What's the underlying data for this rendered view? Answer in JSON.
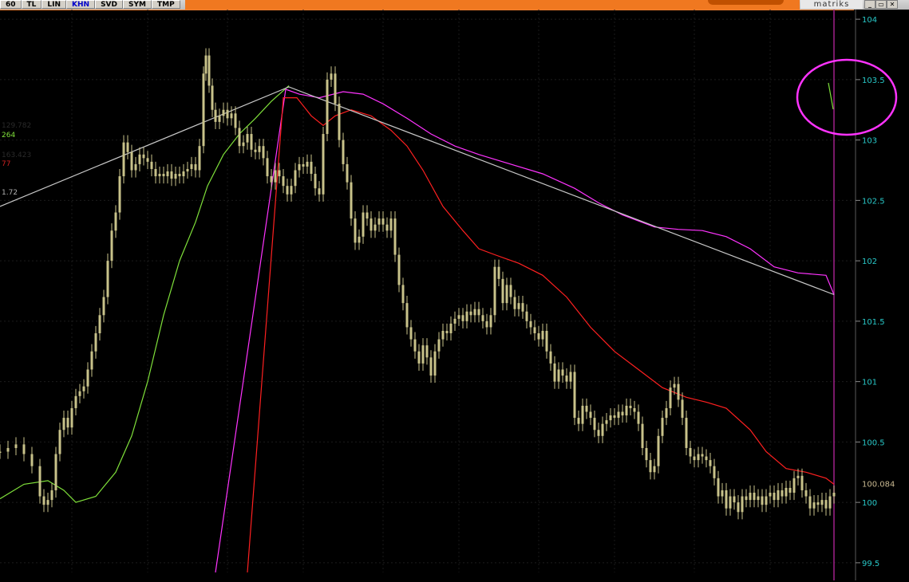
{
  "toolbar": {
    "buttons": [
      "60",
      "TL",
      "LIN",
      "KHN",
      "SVD",
      "SYM",
      "TMP"
    ],
    "active": "KHN",
    "brand": "matriks",
    "window_controls": [
      "_",
      "▭",
      "✕"
    ]
  },
  "colors": {
    "background": "#000000",
    "candle": "#c8c28a",
    "ma_magenta": "#ff33ff",
    "ma_red": "#ff2020",
    "ma_green": "#7fe03a",
    "trendline": "#c8c8c8",
    "axis_labels": "#28c8c8",
    "highlight_circle": "#ff33ff"
  },
  "legend": [
    {
      "text": "129.782",
      "color": "#2a2a2a"
    },
    {
      "text": "264",
      "color": "#7fe03a"
    },
    {
      "text": "163.423",
      "color": "#2a2a2a"
    },
    {
      "text": "77",
      "color": "#d02020"
    },
    {
      "text": "1.72",
      "color": "#b0b0b0"
    }
  ],
  "chart_data": {
    "type": "line",
    "subtype": "candlestick",
    "ylim": [
      99.42,
      104.08
    ],
    "yticks": [
      99.5,
      100,
      100.5,
      101,
      101.5,
      102,
      102.5,
      103,
      103.5,
      104
    ],
    "ytick_labels": [
      "99.5",
      "100",
      "100.5",
      "101",
      "101.5",
      "102",
      "102.5",
      "103",
      "103.5",
      "104"
    ],
    "last_price": "100.084",
    "x_index_range": [
      0,
      1045
    ],
    "candles_close": [
      [
        0,
        100.42
      ],
      [
        10,
        100.45
      ],
      [
        20,
        100.48
      ],
      [
        30,
        100.4
      ],
      [
        40,
        100.3
      ],
      [
        50,
        100.05
      ],
      [
        55,
        99.98
      ],
      [
        60,
        100.02
      ],
      [
        65,
        100.1
      ],
      [
        70,
        100.4
      ],
      [
        75,
        100.6
      ],
      [
        80,
        100.7
      ],
      [
        85,
        100.62
      ],
      [
        90,
        100.78
      ],
      [
        95,
        100.88
      ],
      [
        100,
        100.92
      ],
      [
        105,
        100.96
      ],
      [
        110,
        101.1
      ],
      [
        115,
        101.25
      ],
      [
        120,
        101.4
      ],
      [
        125,
        101.55
      ],
      [
        130,
        101.7
      ],
      [
        135,
        102.0
      ],
      [
        140,
        102.25
      ],
      [
        145,
        102.4
      ],
      [
        150,
        102.7
      ],
      [
        155,
        102.98
      ],
      [
        160,
        102.9
      ],
      [
        165,
        102.75
      ],
      [
        170,
        102.8
      ],
      [
        175,
        102.88
      ],
      [
        180,
        102.85
      ],
      [
        185,
        102.82
      ],
      [
        190,
        102.76
      ],
      [
        195,
        102.7
      ],
      [
        200,
        102.72
      ],
      [
        205,
        102.7
      ],
      [
        210,
        102.74
      ],
      [
        215,
        102.68
      ],
      [
        220,
        102.72
      ],
      [
        225,
        102.7
      ],
      [
        230,
        102.74
      ],
      [
        235,
        102.76
      ],
      [
        240,
        102.8
      ],
      [
        245,
        102.75
      ],
      [
        250,
        102.95
      ],
      [
        255,
        103.55
      ],
      [
        258,
        103.7
      ],
      [
        262,
        103.45
      ],
      [
        266,
        103.25
      ],
      [
        270,
        103.15
      ],
      [
        275,
        103.2
      ],
      [
        280,
        103.25
      ],
      [
        285,
        103.18
      ],
      [
        290,
        103.22
      ],
      [
        295,
        103.1
      ],
      [
        300,
        102.95
      ],
      [
        305,
        102.98
      ],
      [
        310,
        103.05
      ],
      [
        315,
        102.92
      ],
      [
        320,
        102.9
      ],
      [
        325,
        102.95
      ],
      [
        330,
        102.85
      ],
      [
        335,
        102.7
      ],
      [
        340,
        102.65
      ],
      [
        345,
        102.75
      ],
      [
        350,
        102.7
      ],
      [
        355,
        102.62
      ],
      [
        360,
        102.55
      ],
      [
        365,
        102.62
      ],
      [
        370,
        102.75
      ],
      [
        375,
        102.8
      ],
      [
        380,
        102.78
      ],
      [
        385,
        102.82
      ],
      [
        390,
        102.72
      ],
      [
        395,
        102.6
      ],
      [
        400,
        102.55
      ],
      [
        405,
        103.05
      ],
      [
        410,
        103.5
      ],
      [
        415,
        103.55
      ],
      [
        420,
        103.3
      ],
      [
        425,
        103.0
      ],
      [
        430,
        102.8
      ],
      [
        435,
        102.65
      ],
      [
        440,
        102.35
      ],
      [
        445,
        102.15
      ],
      [
        450,
        102.2
      ],
      [
        455,
        102.4
      ],
      [
        460,
        102.35
      ],
      [
        465,
        102.25
      ],
      [
        470,
        102.3
      ],
      [
        475,
        102.35
      ],
      [
        480,
        102.3
      ],
      [
        485,
        102.25
      ],
      [
        490,
        102.35
      ],
      [
        495,
        102.05
      ],
      [
        500,
        101.8
      ],
      [
        505,
        101.65
      ],
      [
        510,
        101.45
      ],
      [
        515,
        101.35
      ],
      [
        520,
        101.25
      ],
      [
        525,
        101.15
      ],
      [
        530,
        101.3
      ],
      [
        535,
        101.2
      ],
      [
        540,
        101.05
      ],
      [
        545,
        101.25
      ],
      [
        550,
        101.35
      ],
      [
        555,
        101.42
      ],
      [
        560,
        101.4
      ],
      [
        565,
        101.48
      ],
      [
        570,
        101.52
      ],
      [
        575,
        101.55
      ],
      [
        580,
        101.5
      ],
      [
        585,
        101.58
      ],
      [
        590,
        101.55
      ],
      [
        595,
        101.6
      ],
      [
        600,
        101.55
      ],
      [
        605,
        101.5
      ],
      [
        610,
        101.45
      ],
      [
        615,
        101.55
      ],
      [
        620,
        101.95
      ],
      [
        625,
        101.85
      ],
      [
        630,
        101.65
      ],
      [
        635,
        101.8
      ],
      [
        640,
        101.7
      ],
      [
        645,
        101.6
      ],
      [
        650,
        101.65
      ],
      [
        655,
        101.58
      ],
      [
        660,
        101.5
      ],
      [
        665,
        101.45
      ],
      [
        670,
        101.4
      ],
      [
        675,
        101.35
      ],
      [
        680,
        101.42
      ],
      [
        685,
        101.25
      ],
      [
        690,
        101.15
      ],
      [
        695,
        101.0
      ],
      [
        700,
        101.1
      ],
      [
        705,
        101.05
      ],
      [
        710,
        101.0
      ],
      [
        715,
        101.08
      ],
      [
        720,
        100.7
      ],
      [
        725,
        100.65
      ],
      [
        730,
        100.8
      ],
      [
        735,
        100.75
      ],
      [
        740,
        100.7
      ],
      [
        745,
        100.6
      ],
      [
        750,
        100.55
      ],
      [
        755,
        100.65
      ],
      [
        760,
        100.68
      ],
      [
        765,
        100.72
      ],
      [
        770,
        100.7
      ],
      [
        775,
        100.75
      ],
      [
        780,
        100.72
      ],
      [
        785,
        100.8
      ],
      [
        790,
        100.78
      ],
      [
        795,
        100.75
      ],
      [
        800,
        100.65
      ],
      [
        805,
        100.45
      ],
      [
        810,
        100.35
      ],
      [
        815,
        100.25
      ],
      [
        820,
        100.3
      ],
      [
        825,
        100.55
      ],
      [
        830,
        100.7
      ],
      [
        835,
        100.78
      ],
      [
        840,
        100.95
      ],
      [
        845,
        100.98
      ],
      [
        850,
        100.85
      ],
      [
        855,
        100.7
      ],
      [
        860,
        100.45
      ],
      [
        865,
        100.38
      ],
      [
        870,
        100.35
      ],
      [
        875,
        100.4
      ],
      [
        880,
        100.38
      ],
      [
        885,
        100.35
      ],
      [
        890,
        100.3
      ],
      [
        895,
        100.2
      ],
      [
        900,
        100.05
      ],
      [
        905,
        100.1
      ],
      [
        910,
        99.95
      ],
      [
        915,
        100.05
      ],
      [
        920,
        100.0
      ],
      [
        925,
        99.92
      ],
      [
        930,
        100.05
      ],
      [
        935,
        100.02
      ],
      [
        940,
        100.08
      ],
      [
        945,
        100.02
      ],
      [
        950,
        100.05
      ],
      [
        955,
        99.98
      ],
      [
        960,
        100.05
      ],
      [
        965,
        100.08
      ],
      [
        970,
        100.02
      ],
      [
        975,
        100.1
      ],
      [
        980,
        100.05
      ],
      [
        985,
        100.12
      ],
      [
        990,
        100.08
      ],
      [
        995,
        100.2
      ],
      [
        1000,
        100.22
      ],
      [
        1005,
        100.1
      ],
      [
        1010,
        100.05
      ],
      [
        1015,
        99.95
      ],
      [
        1020,
        100.0
      ],
      [
        1025,
        99.98
      ],
      [
        1030,
        100.02
      ],
      [
        1035,
        99.95
      ],
      [
        1040,
        100.05
      ],
      [
        1045,
        100.08
      ]
    ],
    "series": [
      {
        "key": "ma_magenta",
        "points": [
          [
            270,
            99.42
          ],
          [
            358,
            103.42
          ],
          [
            375,
            103.38
          ],
          [
            400,
            103.35
          ],
          [
            430,
            103.4
          ],
          [
            455,
            103.38
          ],
          [
            480,
            103.3
          ],
          [
            510,
            103.18
          ],
          [
            540,
            103.05
          ],
          [
            570,
            102.95
          ],
          [
            600,
            102.88
          ],
          [
            640,
            102.8
          ],
          [
            680,
            102.72
          ],
          [
            720,
            102.6
          ],
          [
            750,
            102.48
          ],
          [
            780,
            102.38
          ],
          [
            820,
            102.28
          ],
          [
            850,
            102.26
          ],
          [
            880,
            102.25
          ],
          [
            910,
            102.2
          ],
          [
            940,
            102.1
          ],
          [
            970,
            101.95
          ],
          [
            1000,
            101.9
          ],
          [
            1035,
            101.88
          ],
          [
            1045,
            101.72
          ]
        ]
      },
      {
        "key": "ma_red",
        "points": [
          [
            310,
            99.42
          ],
          [
            355,
            103.35
          ],
          [
            372,
            103.35
          ],
          [
            390,
            103.2
          ],
          [
            405,
            103.12
          ],
          [
            420,
            103.2
          ],
          [
            440,
            103.25
          ],
          [
            465,
            103.2
          ],
          [
            490,
            103.08
          ],
          [
            510,
            102.95
          ],
          [
            530,
            102.75
          ],
          [
            555,
            102.45
          ],
          [
            580,
            102.25
          ],
          [
            600,
            102.1
          ],
          [
            620,
            102.05
          ],
          [
            650,
            101.98
          ],
          [
            680,
            101.88
          ],
          [
            710,
            101.7
          ],
          [
            740,
            101.45
          ],
          [
            770,
            101.25
          ],
          [
            800,
            101.1
          ],
          [
            830,
            100.95
          ],
          [
            860,
            100.87
          ],
          [
            885,
            100.83
          ],
          [
            910,
            100.78
          ],
          [
            940,
            100.6
          ],
          [
            960,
            100.42
          ],
          [
            985,
            100.28
          ],
          [
            1010,
            100.25
          ],
          [
            1035,
            100.2
          ],
          [
            1045,
            100.15
          ]
        ]
      },
      {
        "key": "ma_green",
        "points": [
          [
            0,
            100.03
          ],
          [
            30,
            100.15
          ],
          [
            60,
            100.18
          ],
          [
            80,
            100.1
          ],
          [
            95,
            100.0
          ],
          [
            120,
            100.05
          ],
          [
            145,
            100.25
          ],
          [
            165,
            100.55
          ],
          [
            185,
            101.0
          ],
          [
            205,
            101.55
          ],
          [
            225,
            102.0
          ],
          [
            245,
            102.32
          ],
          [
            260,
            102.62
          ],
          [
            280,
            102.88
          ],
          [
            300,
            103.05
          ],
          [
            320,
            103.18
          ],
          [
            340,
            103.32
          ],
          [
            362,
            103.45
          ]
        ]
      },
      {
        "key": "trendline",
        "points": [
          [
            0,
            102.45
          ],
          [
            362,
            103.44
          ],
          [
            1045,
            101.72
          ]
        ]
      }
    ]
  }
}
